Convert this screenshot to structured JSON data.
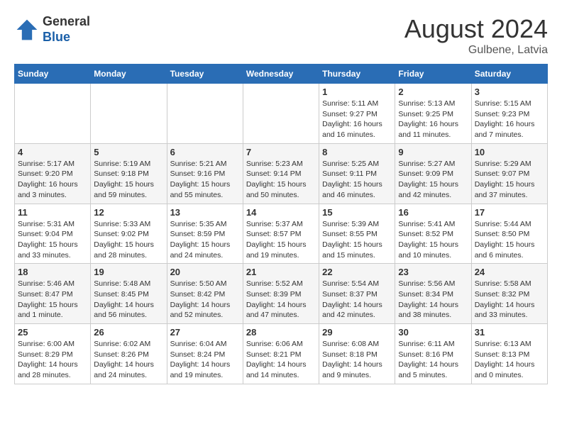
{
  "header": {
    "logo_general": "General",
    "logo_blue": "Blue",
    "title": "August 2024",
    "subtitle": "Gulbene, Latvia"
  },
  "calendar": {
    "days_of_week": [
      "Sunday",
      "Monday",
      "Tuesday",
      "Wednesday",
      "Thursday",
      "Friday",
      "Saturday"
    ],
    "weeks": [
      [
        {
          "day": "",
          "info": ""
        },
        {
          "day": "",
          "info": ""
        },
        {
          "day": "",
          "info": ""
        },
        {
          "day": "",
          "info": ""
        },
        {
          "day": "1",
          "info": "Sunrise: 5:11 AM\nSunset: 9:27 PM\nDaylight: 16 hours\nand 16 minutes."
        },
        {
          "day": "2",
          "info": "Sunrise: 5:13 AM\nSunset: 9:25 PM\nDaylight: 16 hours\nand 11 minutes."
        },
        {
          "day": "3",
          "info": "Sunrise: 5:15 AM\nSunset: 9:23 PM\nDaylight: 16 hours\nand 7 minutes."
        }
      ],
      [
        {
          "day": "4",
          "info": "Sunrise: 5:17 AM\nSunset: 9:20 PM\nDaylight: 16 hours\nand 3 minutes."
        },
        {
          "day": "5",
          "info": "Sunrise: 5:19 AM\nSunset: 9:18 PM\nDaylight: 15 hours\nand 59 minutes."
        },
        {
          "day": "6",
          "info": "Sunrise: 5:21 AM\nSunset: 9:16 PM\nDaylight: 15 hours\nand 55 minutes."
        },
        {
          "day": "7",
          "info": "Sunrise: 5:23 AM\nSunset: 9:14 PM\nDaylight: 15 hours\nand 50 minutes."
        },
        {
          "day": "8",
          "info": "Sunrise: 5:25 AM\nSunset: 9:11 PM\nDaylight: 15 hours\nand 46 minutes."
        },
        {
          "day": "9",
          "info": "Sunrise: 5:27 AM\nSunset: 9:09 PM\nDaylight: 15 hours\nand 42 minutes."
        },
        {
          "day": "10",
          "info": "Sunrise: 5:29 AM\nSunset: 9:07 PM\nDaylight: 15 hours\nand 37 minutes."
        }
      ],
      [
        {
          "day": "11",
          "info": "Sunrise: 5:31 AM\nSunset: 9:04 PM\nDaylight: 15 hours\nand 33 minutes."
        },
        {
          "day": "12",
          "info": "Sunrise: 5:33 AM\nSunset: 9:02 PM\nDaylight: 15 hours\nand 28 minutes."
        },
        {
          "day": "13",
          "info": "Sunrise: 5:35 AM\nSunset: 8:59 PM\nDaylight: 15 hours\nand 24 minutes."
        },
        {
          "day": "14",
          "info": "Sunrise: 5:37 AM\nSunset: 8:57 PM\nDaylight: 15 hours\nand 19 minutes."
        },
        {
          "day": "15",
          "info": "Sunrise: 5:39 AM\nSunset: 8:55 PM\nDaylight: 15 hours\nand 15 minutes."
        },
        {
          "day": "16",
          "info": "Sunrise: 5:41 AM\nSunset: 8:52 PM\nDaylight: 15 hours\nand 10 minutes."
        },
        {
          "day": "17",
          "info": "Sunrise: 5:44 AM\nSunset: 8:50 PM\nDaylight: 15 hours\nand 6 minutes."
        }
      ],
      [
        {
          "day": "18",
          "info": "Sunrise: 5:46 AM\nSunset: 8:47 PM\nDaylight: 15 hours\nand 1 minute."
        },
        {
          "day": "19",
          "info": "Sunrise: 5:48 AM\nSunset: 8:45 PM\nDaylight: 14 hours\nand 56 minutes."
        },
        {
          "day": "20",
          "info": "Sunrise: 5:50 AM\nSunset: 8:42 PM\nDaylight: 14 hours\nand 52 minutes."
        },
        {
          "day": "21",
          "info": "Sunrise: 5:52 AM\nSunset: 8:39 PM\nDaylight: 14 hours\nand 47 minutes."
        },
        {
          "day": "22",
          "info": "Sunrise: 5:54 AM\nSunset: 8:37 PM\nDaylight: 14 hours\nand 42 minutes."
        },
        {
          "day": "23",
          "info": "Sunrise: 5:56 AM\nSunset: 8:34 PM\nDaylight: 14 hours\nand 38 minutes."
        },
        {
          "day": "24",
          "info": "Sunrise: 5:58 AM\nSunset: 8:32 PM\nDaylight: 14 hours\nand 33 minutes."
        }
      ],
      [
        {
          "day": "25",
          "info": "Sunrise: 6:00 AM\nSunset: 8:29 PM\nDaylight: 14 hours\nand 28 minutes."
        },
        {
          "day": "26",
          "info": "Sunrise: 6:02 AM\nSunset: 8:26 PM\nDaylight: 14 hours\nand 24 minutes."
        },
        {
          "day": "27",
          "info": "Sunrise: 6:04 AM\nSunset: 8:24 PM\nDaylight: 14 hours\nand 19 minutes."
        },
        {
          "day": "28",
          "info": "Sunrise: 6:06 AM\nSunset: 8:21 PM\nDaylight: 14 hours\nand 14 minutes."
        },
        {
          "day": "29",
          "info": "Sunrise: 6:08 AM\nSunset: 8:18 PM\nDaylight: 14 hours\nand 9 minutes."
        },
        {
          "day": "30",
          "info": "Sunrise: 6:11 AM\nSunset: 8:16 PM\nDaylight: 14 hours\nand 5 minutes."
        },
        {
          "day": "31",
          "info": "Sunrise: 6:13 AM\nSunset: 8:13 PM\nDaylight: 14 hours\nand 0 minutes."
        }
      ]
    ]
  }
}
